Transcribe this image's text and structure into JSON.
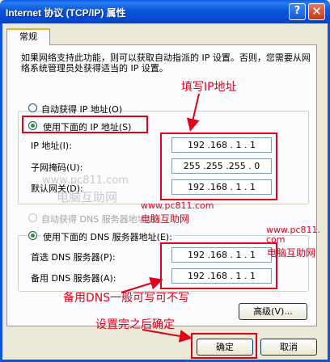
{
  "window": {
    "title": "Internet 协议 (TCP/IP) 属性",
    "help_glyph": "?",
    "close_glyph": "✕"
  },
  "tab": {
    "label": "常规"
  },
  "info_text": "如果网络支持此功能，则可以获取自动指派的 IP 设置。否则，您需要从网络系统管理员处获得适当的 IP 设置。",
  "ip_section": {
    "auto_label": "自动获得 IP 地址(O)",
    "manual_label": "使用下面的 IP 地址(S)",
    "selected": "manual",
    "fields": [
      {
        "label": "IP 地址(I):",
        "value": "192 .168 . 1 . 1"
      },
      {
        "label": "子网掩码(U):",
        "value": "255 .255 .255 . 0"
      },
      {
        "label": "默认网关(D):",
        "value": "192 .168 . 1 . 1"
      }
    ]
  },
  "dns_section": {
    "auto_label": "自动获得 DNS 服务器地址(B)",
    "manual_label": "使用下面的 DNS 服务器地址(E):",
    "selected": "manual",
    "fields": [
      {
        "label": "首选 DNS 服务器(P):",
        "value": "192 .168 . 1 . 1"
      },
      {
        "label": "备用 DNS 服务器(A):",
        "value": "192 .168 . 1 . 1"
      }
    ]
  },
  "buttons": {
    "advanced": "高级(V)...",
    "ok": "确定",
    "cancel": "取消"
  },
  "annotations": {
    "fill_ip": "填写IP地址",
    "dns_optional": "备用DNS一般可写可不写",
    "confirm": "设置完之后确定"
  },
  "watermarks": {
    "grey_url": "www.pc811.com",
    "grey_name": "电脑互助网",
    "red_url_1": "www.pc811.com",
    "red_name_1": "电脑互助网",
    "red_url_2": "www.pc811.",
    "red_url_2b": "com",
    "red_name_2": "电脑互助网"
  },
  "colors": {
    "titlebar": "#0a56dc",
    "annotation_red": "#e0001a",
    "dialog_bg": "#ece9d8",
    "radio_dot": "#21a121"
  }
}
